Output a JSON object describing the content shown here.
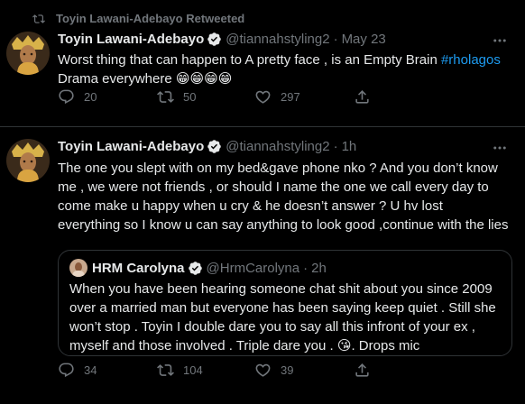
{
  "retweet_banner": {
    "label": "Toyin Lawani-Adebayo Retweeted"
  },
  "tweets": [
    {
      "author_name": "Toyin Lawani-Adebayo",
      "handle": "@tiannahstyling2",
      "dot": "·",
      "time": "May 23",
      "text_part1": "Worst thing that can happen to A pretty face , is an Empty Brain ",
      "hashtag": "#rholagos",
      "text_part2": "Drama everywhere ",
      "emojis": "😁😁😁😁",
      "stats": {
        "replies": "20",
        "retweets": "50",
        "likes": "297"
      }
    },
    {
      "author_name": "Toyin Lawani-Adebayo",
      "handle": "@tiannahstyling2",
      "dot": "·",
      "time": "1h",
      "text": "The one you slept with on my bed&gave phone nko ? And you don’t know me , we were not friends , or should I name the one we call every day to come make u happy when u cry & he doesn’t answer ? U hv lost everything so I know u can say anything to look good ,continue with the lies",
      "quote": {
        "author_name": "HRM Carolyna",
        "handle": "@HrmCarolyna",
        "dot": "·",
        "time": "2h",
        "text": "When you have been hearing someone chat shit about you since 2009 over a married man but everyone has been saying keep quiet . Still she won’t stop . Toyin I double dare you to say all this infront of your ex  , myself and those involved . Triple dare you . ",
        "emoji": "😘",
        "text_end": ". Drops mic"
      },
      "stats": {
        "replies": "34",
        "retweets": "104",
        "likes": "39"
      }
    }
  ],
  "colors": {
    "background": "#000000",
    "text": "#e7e9ea",
    "muted": "#71767b",
    "accent": "#1d9bf0",
    "border": "#2f3336"
  },
  "icons": [
    "retweet-icon",
    "verified-badge-icon",
    "more-icon",
    "reply-icon",
    "like-icon",
    "share-icon"
  ]
}
